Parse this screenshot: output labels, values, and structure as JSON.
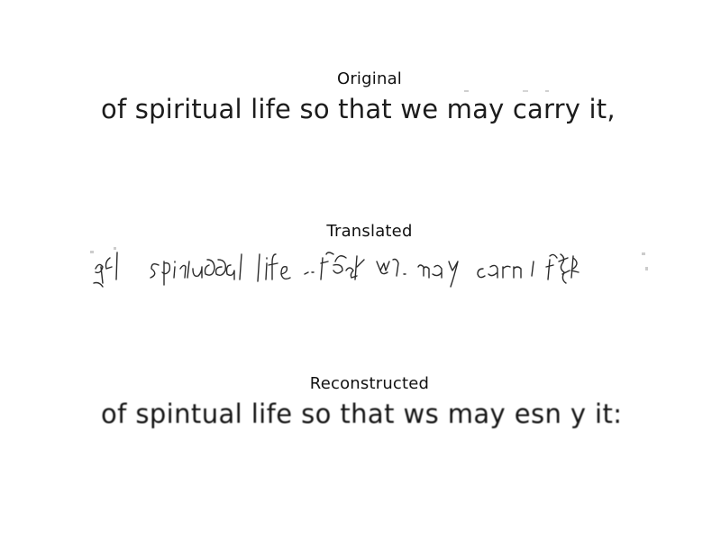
{
  "panels": {
    "original": {
      "title": "Original",
      "text": "of spiritual life so that we may carry it,"
    },
    "translated": {
      "title": "Translated"
    },
    "reconstructed": {
      "title": "Reconstructed",
      "text": "of spintual life so that ws may esn y it:"
    }
  },
  "colors": {
    "background": "#ffffff",
    "ink": "#1c1c1c",
    "title": "#111111"
  }
}
